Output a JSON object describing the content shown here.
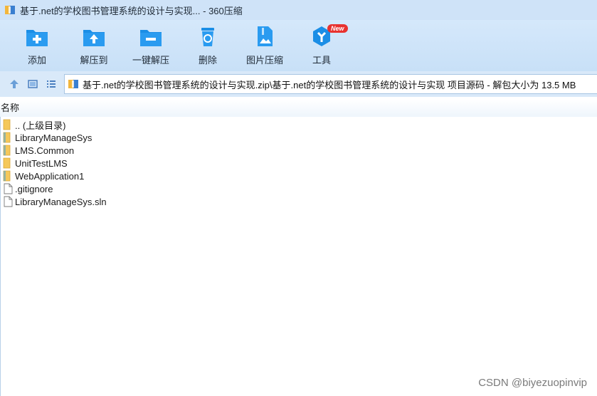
{
  "window": {
    "title": "基于.net的学校图书管理系统的设计与实现... - 360压缩"
  },
  "toolbar": {
    "items": [
      {
        "label": "添加",
        "icon": "add-icon"
      },
      {
        "label": "解压到",
        "icon": "extract-to-icon"
      },
      {
        "label": "一键解压",
        "icon": "one-click-extract-icon"
      },
      {
        "label": "删除",
        "icon": "delete-icon"
      },
      {
        "label": "图片压缩",
        "icon": "image-compress-icon"
      },
      {
        "label": "工具",
        "icon": "tools-icon",
        "badge": "New"
      }
    ]
  },
  "navbar": {
    "path": "基于.net的学校图书管理系统的设计与实现.zip\\基于.net的学校图书管理系统的设计与实现 项目源码 - 解包大小为 13.5 MB"
  },
  "list": {
    "column_header": "名称",
    "items": [
      {
        "name": ".. (上级目录)",
        "type": "folder"
      },
      {
        "name": "LibraryManageSys",
        "type": "folder"
      },
      {
        "name": "LMS.Common",
        "type": "folder"
      },
      {
        "name": "UnitTestLMS",
        "type": "folder"
      },
      {
        "name": "WebApplication1",
        "type": "folder"
      },
      {
        "name": ".gitignore",
        "type": "file"
      },
      {
        "name": "LibraryManageSys.sln",
        "type": "file"
      }
    ]
  },
  "watermark": "CSDN @biyezuopinvip",
  "colors": {
    "accent": "#1b8ee6",
    "badge": "#e8322f",
    "folder": "#f5c85a"
  }
}
